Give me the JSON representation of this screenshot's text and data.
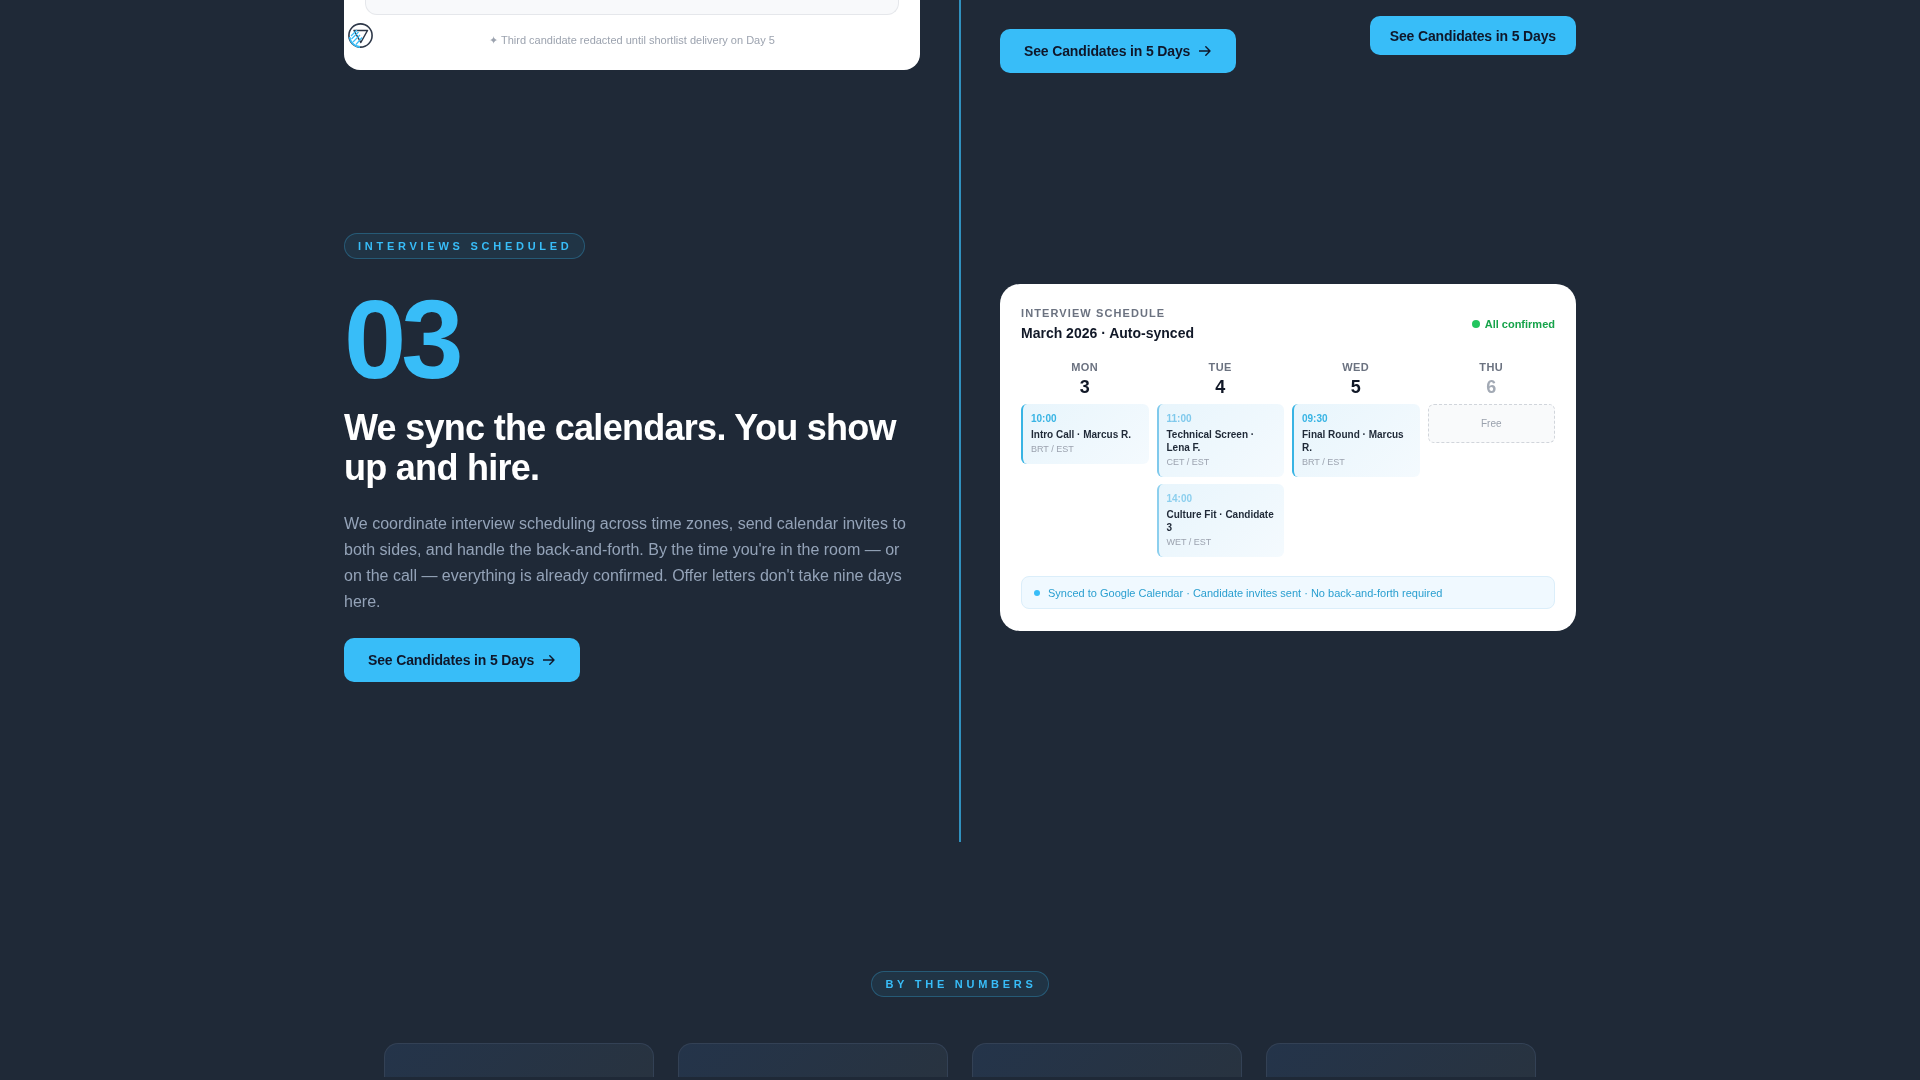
{
  "top_card": {
    "caption": "✦ Third candidate redacted until shortlist delivery on Day 5"
  },
  "top_buttons": [
    {
      "label": "See Candidates in 5 Days",
      "arrow": true
    },
    {
      "label": "See Candidates in 5 Days",
      "arrow": false
    }
  ],
  "intro": {
    "badge": "INTERVIEWS SCHEDULED",
    "number": "03",
    "heading": "We sync the calendars. You show up and hire.",
    "body": "We coordinate interview scheduling across time zones, send calendar invites to both sides, and handle the back-and-forth. By the time you're in the room — or on the call — everything is already confirmed. Offer letters don't take nine days here.",
    "button": {
      "label": "See Candidates in 5 Days",
      "arrow": true
    }
  },
  "schedule_card": {
    "eyebrow": "INTERVIEW SCHEDULE",
    "title": "March 2026 · Auto-synced",
    "status": "All confirmed",
    "days": [
      {
        "name": "MON",
        "date": "3",
        "free": false,
        "events": [
          {
            "kind": "interview",
            "time": "10:00",
            "title": "Intro Call · Marcus R.",
            "zones": "BRT / EST",
            "color": "#38b4e4"
          }
        ]
      },
      {
        "name": "TUE",
        "date": "4",
        "free": false,
        "events": [
          {
            "kind": "interview",
            "time": "11:00",
            "title": "Technical Screen · Lena F.",
            "zones": "CET / EST",
            "color": "#7fc9ec"
          },
          {
            "kind": "interview",
            "time": "14:00",
            "title": "Culture Fit · Candidate 3",
            "zones": "WET / EST",
            "color": "#8ccfee"
          }
        ]
      },
      {
        "name": "WED",
        "date": "5",
        "free": false,
        "events": [
          {
            "kind": "interview",
            "time": "09:30",
            "title": "Final Round · Marcus R.",
            "zones": "BRT / EST",
            "color": "#38b4e4"
          }
        ]
      },
      {
        "name": "THU",
        "date": "6",
        "free": true,
        "events": [
          {
            "kind": "free",
            "label": "Free"
          }
        ]
      }
    ],
    "footer": "Synced to Google Calendar · Candidate invites sent · No back-and-forth required"
  },
  "numbers": {
    "badge": "BY THE NUMBERS"
  }
}
